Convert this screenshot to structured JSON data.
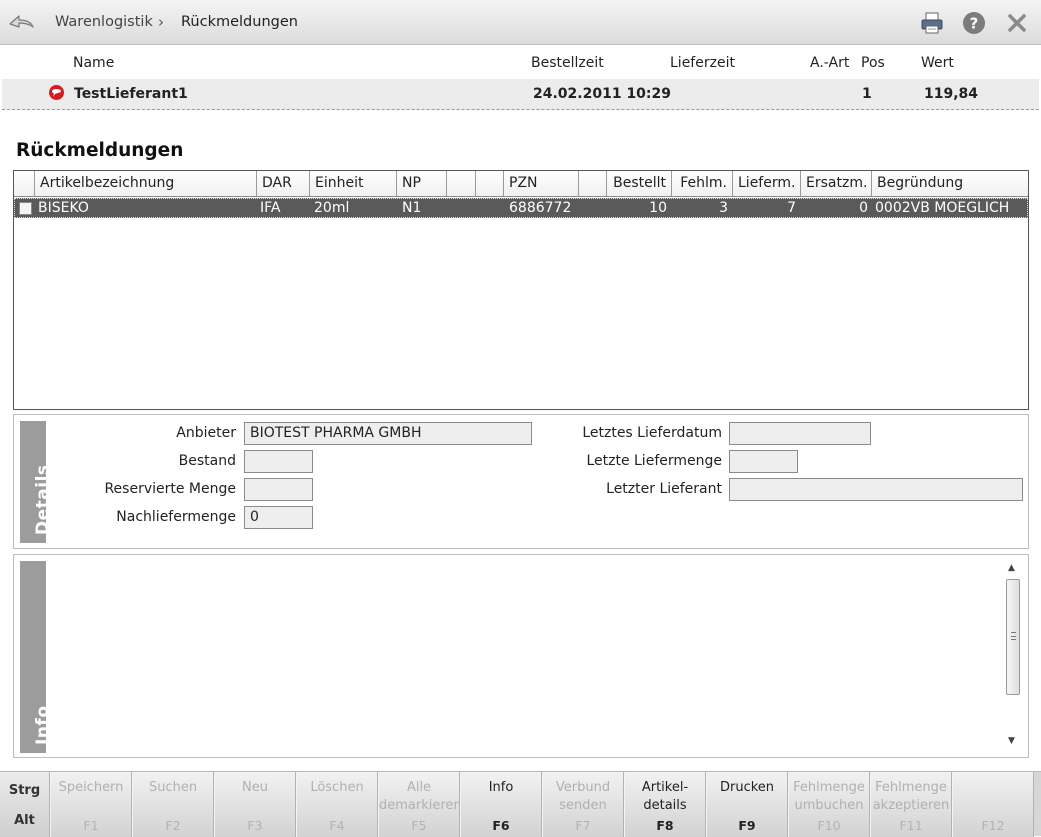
{
  "breadcrumb": {
    "parent": "Warenlogistik",
    "separator": "›",
    "current": "Rückmeldungen"
  },
  "order_header": {
    "columns": {
      "name": "Name",
      "bestellzeit": "Bestellzeit",
      "lieferzeit": "Lieferzeit",
      "aart": "A.-Art",
      "pos": "Pos",
      "wert": "Wert"
    },
    "row": {
      "name": "TestLieferant1",
      "bestellzeit": "24.02.2011 10:29",
      "lieferzeit": "",
      "aart": "",
      "pos": "1",
      "wert": "119,84"
    }
  },
  "section_title": "Rückmeldungen",
  "grid": {
    "headers": {
      "artikel": "Artikelbezeichnung",
      "dar": "DAR",
      "einheit": "Einheit",
      "np": "NP",
      "c1": "",
      "c2": "",
      "pzn": "PZN",
      "c3": "",
      "bestellt": "Bestellt",
      "fehlm": "Fehlm.",
      "lieferm": "Lieferm.",
      "ersatzm": "Ersatzm.",
      "begruendung": "Begründung"
    },
    "rows": [
      {
        "artikel": "BISEKO",
        "dar": "IFA",
        "einheit": "20ml",
        "np": "N1",
        "pzn": "6886772",
        "bestellt": "10",
        "fehlm": "3",
        "lieferm": "7",
        "ersatzm": "0",
        "begruendung": "0002VB MOEGLICH"
      }
    ]
  },
  "details": {
    "tab_label": "Details",
    "anbieter_label": "Anbieter",
    "anbieter_value": "BIOTEST PHARMA GMBH",
    "bestand_label": "Bestand",
    "bestand_value": "",
    "reserviert_label": "Reservierte Menge",
    "reserviert_value": "",
    "nachliefer_label": "Nachliefermenge",
    "nachliefer_value": "0",
    "letztes_datum_label": "Letztes Lieferdatum",
    "letztes_datum_value": "",
    "letzte_menge_label": "Letzte Liefermenge",
    "letzte_menge_value": "",
    "letzter_lieferant_label": "Letzter Lieferant",
    "letzter_lieferant_value": ""
  },
  "info": {
    "tab_label": "Info"
  },
  "modifiers": {
    "strg": "Strg",
    "alt": "Alt"
  },
  "fkeys": [
    {
      "label": "Speichern",
      "key": "F1",
      "enabled": false
    },
    {
      "label": "Suchen",
      "key": "F2",
      "enabled": false
    },
    {
      "label": "Neu",
      "key": "F3",
      "enabled": false
    },
    {
      "label": "Löschen",
      "key": "F4",
      "enabled": false
    },
    {
      "label": "Alle\ndemarkieren",
      "key": "F5",
      "enabled": false
    },
    {
      "label": "Info",
      "key": "F6",
      "enabled": true
    },
    {
      "label": "Verbund\nsenden",
      "key": "F7",
      "enabled": false
    },
    {
      "label": "Artikel-\ndetails",
      "key": "F8",
      "enabled": true
    },
    {
      "label": "Drucken",
      "key": "F9",
      "enabled": true
    },
    {
      "label": "Fehlmenge\numbuchen",
      "key": "F10",
      "enabled": false
    },
    {
      "label": "Fehlmenge\nakzeptieren",
      "key": "F11",
      "enabled": false
    },
    {
      "label": "",
      "key": "F12",
      "enabled": false
    }
  ]
}
